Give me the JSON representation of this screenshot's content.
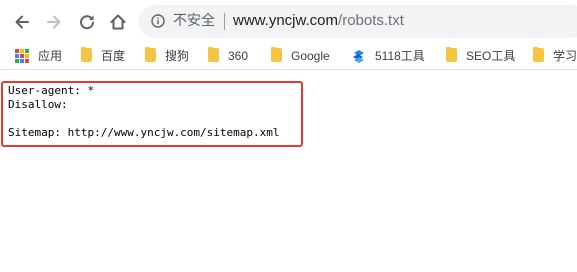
{
  "browser": {
    "icons": {
      "back": "back-arrow-icon",
      "forward": "forward-arrow-icon",
      "reload": "reload-icon",
      "home": "home-icon",
      "info": "info-circle-icon"
    },
    "address_bar": {
      "security_label": "不安全",
      "url_host": "www.yncjw.com",
      "url_path": "/robots.txt"
    }
  },
  "bookmarks": {
    "items": [
      {
        "label": "应用",
        "icon": "apps-grid-icon"
      },
      {
        "label": "百度",
        "icon": "folder-icon"
      },
      {
        "label": "搜狗",
        "icon": "folder-icon"
      },
      {
        "label": "360",
        "icon": "folder-icon"
      },
      {
        "label": "Google",
        "icon": "folder-icon"
      },
      {
        "label": "5118工具",
        "icon": "5118-logo-icon"
      },
      {
        "label": "SEO工具",
        "icon": "folder-icon"
      },
      {
        "label": "学习",
        "icon": "folder-icon"
      }
    ]
  },
  "robots_txt": {
    "lines": [
      "User-agent: *",
      "Disallow:",
      "",
      "Sitemap: http://www.yncjw.com/sitemap.xml"
    ]
  },
  "colors": {
    "highlight_border": "#e53935",
    "folder": "#f5c542",
    "omnibox_bg": "#f1f3f4"
  }
}
